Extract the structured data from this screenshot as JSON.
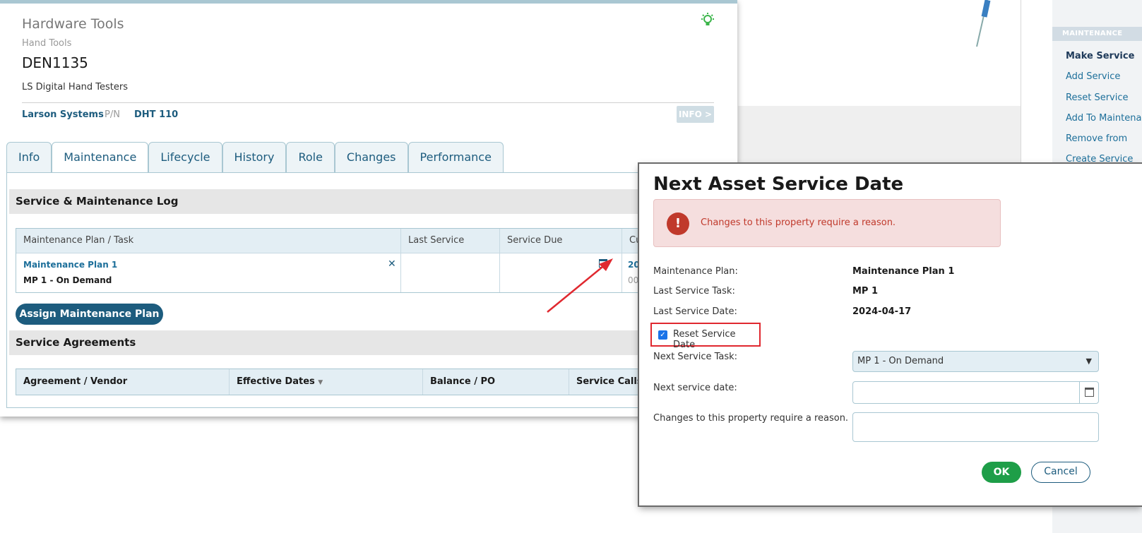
{
  "background": {
    "right_panel_header": "MAINTENANCE",
    "actions": [
      "Make Service",
      "Add Service",
      "Reset Service",
      "Add To Maintenance",
      "Remove from",
      "Create Service"
    ]
  },
  "asset": {
    "category": "Hardware Tools",
    "subcategory": "Hand Tools",
    "id": "DEN1135",
    "description": "LS Digital Hand Testers",
    "manufacturer": "Larson Systems",
    "pn_label": "P/N",
    "pn_value": "DHT 110",
    "info_button": "INFO >"
  },
  "tabs": [
    "Info",
    "Maintenance",
    "Lifecycle",
    "History",
    "Role",
    "Changes",
    "Performance"
  ],
  "active_tab": "Maintenance",
  "maintenance_log": {
    "title": "Service & Maintenance Log",
    "headers": [
      "Maintenance Plan / Task",
      "Last Service",
      "Service Due",
      "Cu"
    ],
    "row": {
      "plan": "Maintenance Plan 1",
      "task": "MP 1 - On Demand",
      "current_1": "20",
      "current_2": "00"
    },
    "assign_button": "Assign Maintenance Plan"
  },
  "service_agreements": {
    "title": "Service Agreements",
    "headers": [
      "Agreement / Vendor",
      "Effective Dates",
      "Balance / PO",
      "Service Calls"
    ]
  },
  "modal": {
    "title": "Next Asset Service Date",
    "alert_text": "Changes to this property require a reason.",
    "maintenance_plan_label": "Maintenance Plan:",
    "maintenance_plan_value": "Maintenance Plan 1",
    "last_task_label": "Last Service Task:",
    "last_task_value": "MP 1",
    "last_date_label": "Last Service Date:",
    "last_date_value": "2024-04-17",
    "reset_label": "Reset Service Date",
    "reset_checked": true,
    "next_task_label": "Next Service Task:",
    "next_task_value": "MP 1 - On Demand",
    "next_date_label": "Next service date:",
    "next_date_value": "",
    "reason_label": "Changes to this property require a reason.",
    "reason_value": "",
    "ok_label": "OK",
    "cancel_label": "Cancel"
  },
  "colors": {
    "primary": "#1d5c7e",
    "ok_green": "#1e9e48",
    "alert_red": "#c0392b",
    "highlight_red": "#e0282f"
  }
}
